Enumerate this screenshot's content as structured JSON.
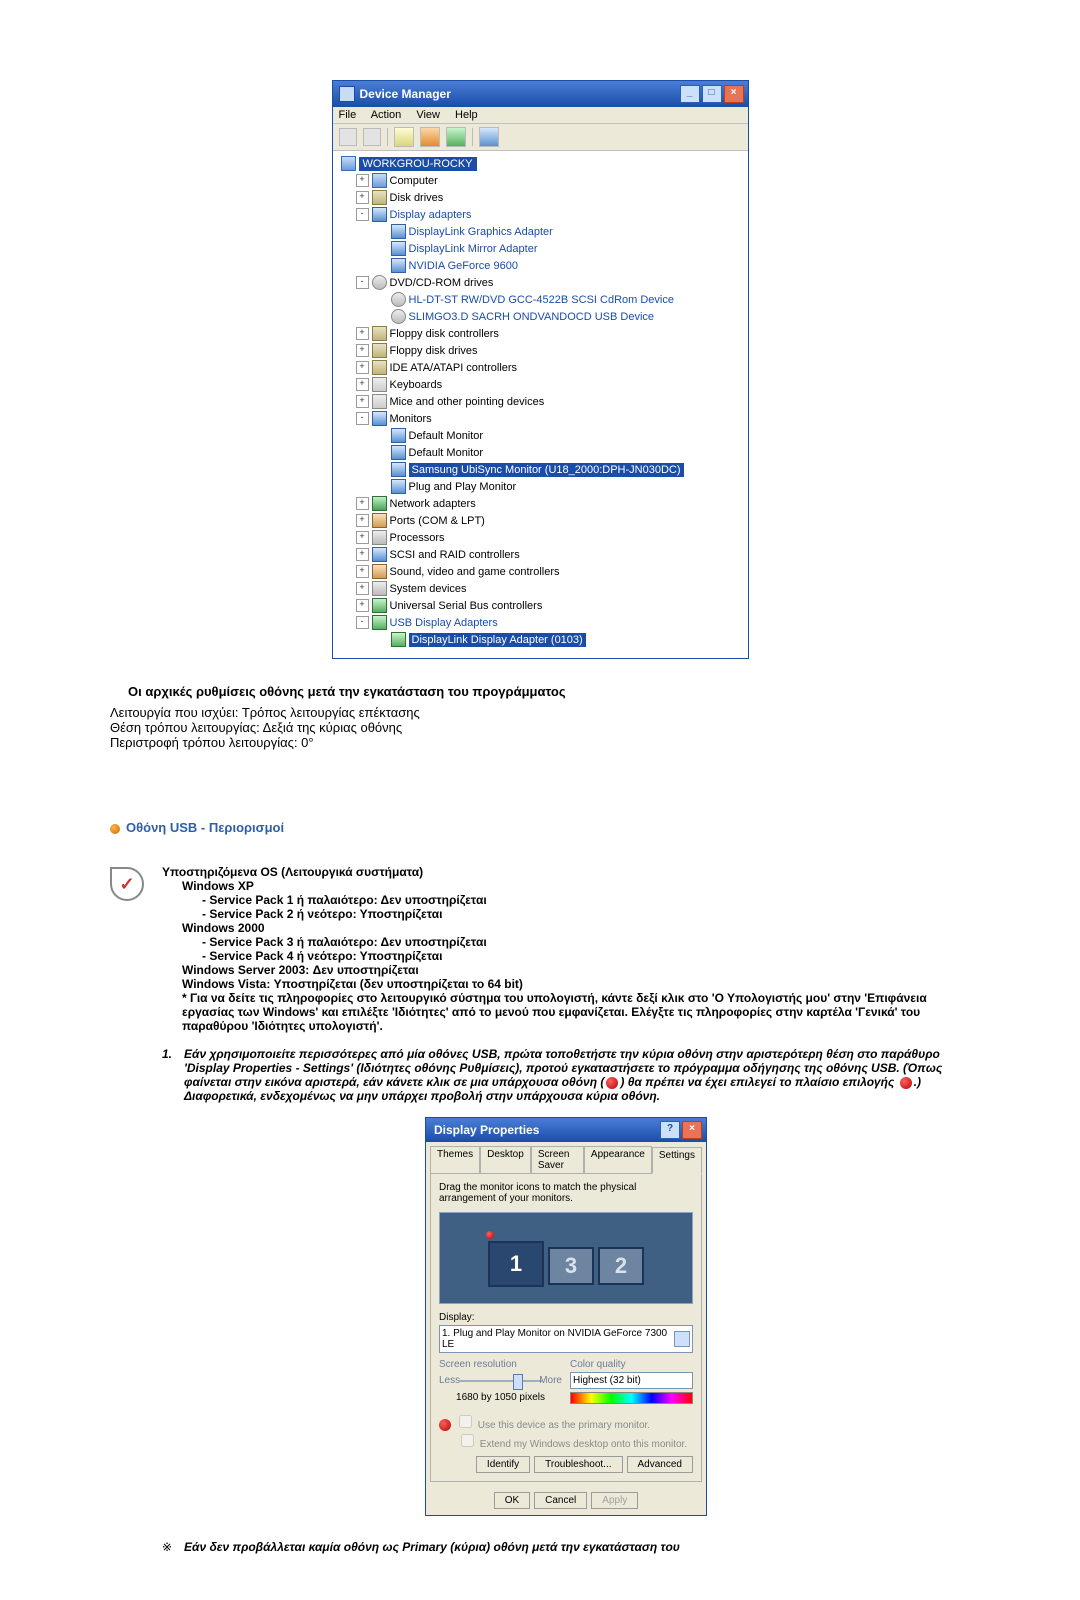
{
  "device_manager": {
    "title": "Device Manager",
    "menu": [
      "File",
      "Action",
      "View",
      "Help"
    ],
    "tree": {
      "root": "WORKGROU-ROCKY",
      "computer": "Computer",
      "disk_drives": "Disk drives",
      "display_adapters": "Display adapters",
      "disp_items": [
        "DisplayLink Graphics Adapter",
        "DisplayLink Mirror Adapter",
        "NVIDIA GeForce 9600"
      ],
      "dvd": "DVD/CD-ROM drives",
      "dvd_items": [
        "HL-DT-ST RW/DVD GCC-4522B SCSI CdRom Device",
        "SLIMGO3.D SACRH ONDVANDOCD USB Device"
      ],
      "floppy_ctrl": "Floppy disk controllers",
      "floppy_drv": "Floppy disk drives",
      "ide": "IDE ATA/ATAPI controllers",
      "keyboards": "Keyboards",
      "mice": "Mice and other pointing devices",
      "monitors": "Monitors",
      "mon_items": [
        "Default Monitor",
        "Default Monitor"
      ],
      "mon_selected": "Samsung UbiSync Monitor (U18_2000:DPH-JN030DC)",
      "mon_after": "Plug and Play Monitor",
      "network": "Network adapters",
      "ports": "Ports (COM & LPT)",
      "processors": "Processors",
      "scsi": "SCSI and RAID controllers",
      "sound": "Sound, video and game controllers",
      "system": "System devices",
      "usb_ctrl": "Universal Serial Bus controllers",
      "usb_adapters": "USB Display Adapters",
      "usb_item": "DisplayLink Display Adapter (0103)"
    }
  },
  "section1": {
    "heading": "Οι αρχικές ρυθμίσεις οθόνης μετά την εγκατάσταση του προγράμματος",
    "p1": "Λειτουργία που ισχύει: Τρόπος λειτουργίας επέκτασης",
    "p2": "Θέση τρόπου λειτουργίας: Δεξιά της κύριας οθόνης",
    "p3": "Περιστροφή τρόπου λειτουργίας: 0°"
  },
  "section2": {
    "heading": "Οθόνη USB - Περιορισμοί",
    "os_title": "Υποστηριζόμενα OS (Λειτουργικά συστήματα)",
    "xp": "Windows XP",
    "xp1": "- Service Pack 1 ή παλαιότερο: Δεν υποστηρίζεται",
    "xp2": "- Service Pack 2 ή νεότερο: Υποστηρίζεται",
    "w2k": "Windows 2000",
    "w2k1": "- Service Pack 3 ή παλαιότερο: Δεν υποστηρίζεται",
    "w2k2": "- Service Pack 4 ή νεότερο: Υποστηρίζεται",
    "ws2003": "Windows Server 2003: Δεν υποστηρίζεται",
    "vista": "Windows Vista: Υποστηρίζεται (δεν υποστηρίζεται το 64 bit)",
    "note": "* Για να δείτε τις πληροφορίες στο λειτουργικό σύστημα του υπολογιστή, κάντε δεξί κλικ στο 'Ο Υπολογιστής μου' στην 'Επιφάνεια εργασίας των Windows' και επιλέξτε 'Ιδιότητες' από το μενού που εμφανίζεται. Ελέγξτε τις πληροφορίες στην καρτέλα 'Γενικά' του παραθύρου 'Ιδιότητες υπολογιστή'.",
    "num1_a": "Εάν χρησιμοποιείτε περισσότερες από μία οθόνες USB, πρώτα τοποθετήστε την κύρια οθόνη στην αριστερότερη θέση στο παράθυρο 'Display Properties - Settings' (Ιδιότητες οθόνης Ρυθμίσεις), προτού εγκαταστήσετε το πρόγραμμα οδήγησης της οθόνης USB. (Όπως φαίνεται στην εικόνα αριστερά, εάν κάνετε κλικ σε μια υπάρχουσα οθόνη (",
    "num1_b": ") θα πρέπει να έχει επιλεγεί το πλαίσιο επιλογής ",
    "num1_c": ".) Διαφορετικά, ενδεχομένως να μην υπάρχει προβολή στην υπάρχουσα κύρια οθόνη."
  },
  "display_properties": {
    "title": "Display Properties",
    "tabs": [
      "Themes",
      "Desktop",
      "Screen Saver",
      "Appearance",
      "Settings"
    ],
    "instruction": "Drag the monitor icons to match the physical arrangement of your monitors.",
    "monitors": {
      "m1": "1",
      "m2": "2",
      "m3": "3"
    },
    "display_label": "Display:",
    "display_value": "1. Plug and Play Monitor on NVIDIA GeForce 7300 LE",
    "screen_res": "Screen resolution",
    "less": "Less",
    "more": "More",
    "res_value": "1680 by 1050 pixels",
    "color_q": "Color quality",
    "color_value": "Highest (32 bit)",
    "chk1": "Use this device as the primary monitor.",
    "chk2": "Extend my Windows desktop onto this monitor.",
    "btns1": [
      "Identify",
      "Troubleshoot...",
      "Advanced"
    ],
    "btns2": [
      "OK",
      "Cancel",
      "Apply"
    ]
  },
  "footnote": "Εάν δεν προβάλλεται καμία οθόνη ως Primary (κύρια) οθόνη μετά την εγκατάσταση του"
}
